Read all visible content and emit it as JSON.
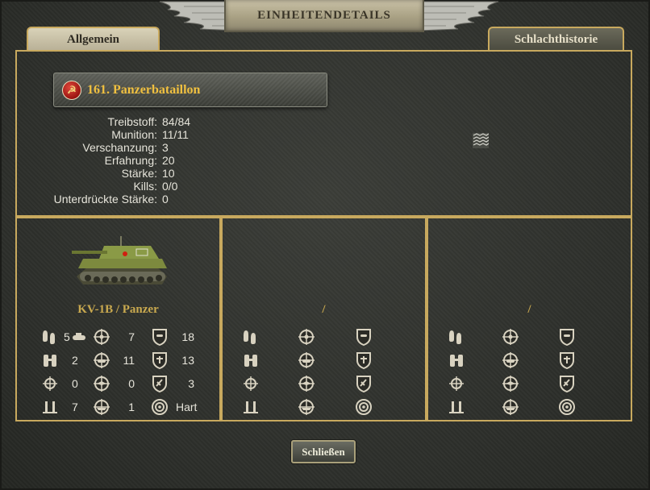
{
  "window": {
    "title": "EINHEITENDETAILS"
  },
  "tabs": [
    {
      "label": "Allgemein",
      "active": true
    },
    {
      "label": "Schlachthistorie",
      "active": false
    }
  ],
  "unit": {
    "name": "161. Panzerbataillon",
    "faction_icon": "soviet-star-badge",
    "stats": [
      {
        "label": "Treibstoff:",
        "value": "84/84"
      },
      {
        "label": "Munition:",
        "value": "11/11"
      },
      {
        "label": "Verschanzung:",
        "value": "3"
      },
      {
        "label": "Erfahrung:",
        "value": "20"
      },
      {
        "label": "Stärke:",
        "value": "10"
      },
      {
        "label": "Kills:",
        "value": "0/0"
      },
      {
        "label": "Unterdrückte Stärke:",
        "value": "0"
      }
    ]
  },
  "slots": [
    {
      "title": "KV-1B / Panzer",
      "values": {
        "movement": "5",
        "movement_type": "tracked",
        "spotting": "2",
        "initiative": "0",
        "range": "7",
        "soft_attack": "7",
        "hard_attack": "11",
        "air_attack": "0",
        "naval_attack": "1",
        "ground_defense": "18",
        "close_defense": "13",
        "air_defense": "3",
        "target_type": "Hart"
      }
    },
    {
      "title": "/",
      "values": {}
    },
    {
      "title": "/",
      "values": {}
    }
  ],
  "close_label": "Schließen",
  "colors": {
    "gold_border": "#c8a95e",
    "unit_name": "#f0c040",
    "faction_red": "#c0201a"
  }
}
